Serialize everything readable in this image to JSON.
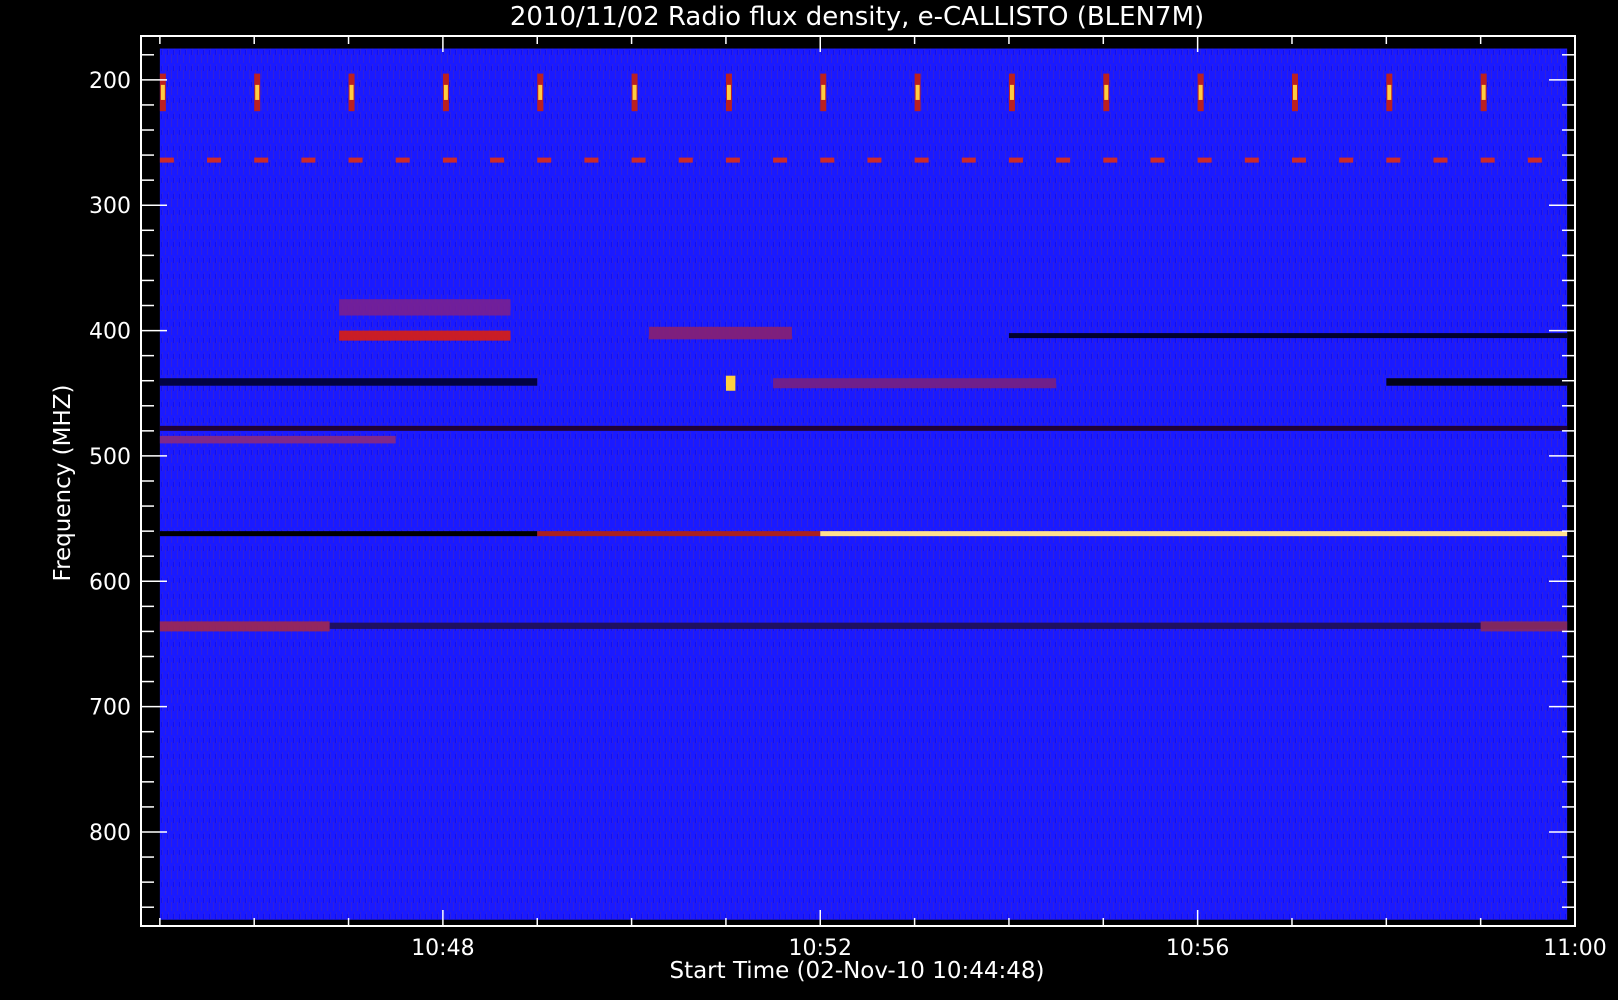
{
  "chart_data": {
    "type": "heatmap",
    "title": "2010/11/02  Radio flux density, e-CALLISTO (BLEN7M)",
    "xlabel": "Start Time (02-Nov-10 10:44:48)",
    "ylabel": "Frequency (MHZ)",
    "x_ticks": [
      "10:48",
      "10:52",
      "10:56",
      "11:00"
    ],
    "x_range": [
      "10:44:48",
      "11:00:00"
    ],
    "data_time_range": [
      "10:45:00",
      "10:59:55"
    ],
    "y_ticks": [
      200,
      300,
      400,
      500,
      600,
      700,
      800
    ],
    "y_range": [
      875,
      165
    ],
    "data_freq_range": [
      870,
      175
    ],
    "y_reversed": true,
    "colormap": [
      "#000000",
      "#1414ff",
      "#5a28c8",
      "#cc1e1e",
      "#ff6000",
      "#ffff80"
    ],
    "features": [
      {
        "kind": "periodic_bursts",
        "freq_band": [
          195,
          225
        ],
        "start": "10:45:00",
        "period_seconds": 60,
        "color": "#ffcc40"
      },
      {
        "kind": "periodic_dashes",
        "freq_band": [
          262,
          266
        ],
        "start": "10:45:00",
        "period_seconds": 30,
        "color": "#cc2a2a"
      },
      {
        "kind": "band",
        "freq_band": [
          400,
          408
        ],
        "start": "10:46:54",
        "end": "10:48:43",
        "color": "#dd1e10"
      },
      {
        "kind": "band",
        "freq_band": [
          375,
          388
        ],
        "start": "10:46:54",
        "end": "10:48:43",
        "color": "#7a2090"
      },
      {
        "kind": "band",
        "freq_band": [
          397,
          407
        ],
        "start": "10:50:11",
        "end": "10:51:42",
        "color": "#8a2070"
      },
      {
        "kind": "band",
        "freq_band": [
          402,
          406
        ],
        "start": "10:54:00",
        "end": "10:59:55",
        "color": "#000018"
      },
      {
        "kind": "band",
        "freq_band": [
          438,
          444
        ],
        "start": "10:45:00",
        "end": "10:49:00",
        "color": "#000030"
      },
      {
        "kind": "band",
        "freq_band": [
          438,
          444
        ],
        "start": "10:58:00",
        "end": "10:59:55",
        "color": "#000000"
      },
      {
        "kind": "band",
        "freq_band": [
          438,
          446
        ],
        "start": "10:51:30",
        "end": "10:54:30",
        "color": "#7a2080"
      },
      {
        "kind": "spot",
        "freq_band": [
          436,
          448
        ],
        "start": "10:51:00",
        "end": "10:51:06",
        "color": "#ffd040"
      },
      {
        "kind": "band",
        "freq_band": [
          476,
          480
        ],
        "start": "10:45:00",
        "end": "10:59:55",
        "color": "#200020"
      },
      {
        "kind": "band",
        "freq_band": [
          484,
          490
        ],
        "start": "10:45:00",
        "end": "10:47:30",
        "color": "#8a2a80"
      },
      {
        "kind": "line",
        "freq_band": [
          560,
          564
        ],
        "start": "10:45:00",
        "end": "10:49:00",
        "color": "#000000"
      },
      {
        "kind": "line",
        "freq_band": [
          560,
          564
        ],
        "start": "10:49:00",
        "end": "10:52:00",
        "color": "#aa2020"
      },
      {
        "kind": "line",
        "freq_band": [
          560,
          564
        ],
        "start": "10:52:00",
        "end": "10:59:55",
        "color": "#ffe090"
      },
      {
        "kind": "band",
        "freq_band": [
          632,
          640
        ],
        "start": "10:45:00",
        "end": "10:46:48",
        "color": "#a02850"
      },
      {
        "kind": "band",
        "freq_band": [
          633,
          638
        ],
        "start": "10:46:48",
        "end": "10:59:55",
        "color": "#201050"
      },
      {
        "kind": "band",
        "freq_band": [
          632,
          640
        ],
        "start": "10:59:00",
        "end": "10:59:55",
        "color": "#8a2a60"
      }
    ]
  }
}
